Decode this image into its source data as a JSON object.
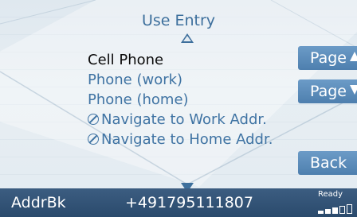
{
  "header": {
    "title": "Use Entry"
  },
  "list": {
    "items": [
      {
        "label": "Cell Phone",
        "selected": true,
        "icon": null
      },
      {
        "label": "Phone (work)",
        "selected": false,
        "icon": null
      },
      {
        "label": "Phone (home)",
        "selected": false,
        "icon": null
      },
      {
        "label": "Navigate to Work Addr.",
        "selected": false,
        "icon": "navigation-icon"
      },
      {
        "label": "Navigate to Home Addr.",
        "selected": false,
        "icon": "navigation-icon"
      }
    ]
  },
  "side_buttons": {
    "page_up_label": "Page",
    "page_down_label": "Page",
    "back_label": "Back"
  },
  "status_bar": {
    "app_label": "AddrBk",
    "phone_number": "+491795111807",
    "ready_label": "Ready",
    "signal_level": "3 of 5 bars"
  },
  "colors": {
    "background": "#e3ebf1",
    "list_text": "#3f73a3",
    "selected_text": "#0a0a0a",
    "button": "#5b8bba",
    "status_bar": "#33557a"
  }
}
